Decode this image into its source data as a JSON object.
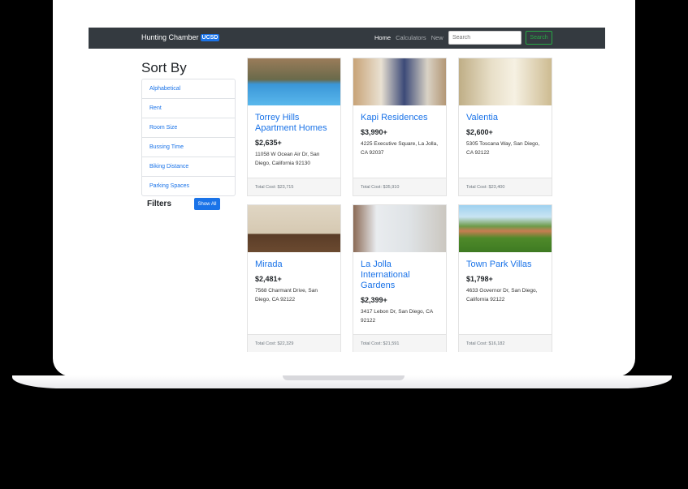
{
  "navbar": {
    "brand": "Hunting Chamber",
    "brand_badge": "UCSD",
    "links": [
      "Home",
      "Calculators",
      "New"
    ],
    "search_placeholder": "Search",
    "search_button": "Search"
  },
  "sidebar": {
    "title": "Sort By",
    "sort_options": [
      "Alphabetical",
      "Rent",
      "Room Size",
      "Bussing Time",
      "Biking Distance",
      "Parking Spaces"
    ],
    "filters_label": "Filters",
    "show_all_label": "Show All"
  },
  "listings": [
    {
      "title": "Torrey Hills Apartment Homes",
      "price": "$2,635+",
      "address": "11058 W Ocean Air Dr, San Diego, California 92130",
      "total": "Total Cost: $23,715"
    },
    {
      "title": "Kapi Residences",
      "price": "$3,990+",
      "address": "4225 Executive Square, La Jolla, CA 92037",
      "total": "Total Cost: $35,910"
    },
    {
      "title": "Valentia",
      "price": "$2,600+",
      "address": "5305 Toscana Way, San Diego, CA 92122",
      "total": "Total Cost: $23,400"
    },
    {
      "title": "Mirada",
      "price": "$2,481+",
      "address": "7568 Charmant Drive, San Diego, CA 92122",
      "total": "Total Cost: $22,329"
    },
    {
      "title": "La Jolla International Gardens",
      "price": "$2,399+",
      "address": "3417 Lebon Dr, San Diego, CA 92122",
      "total": "Total Cost: $21,591"
    },
    {
      "title": "Town Park Villas",
      "price": "$1,798+",
      "address": "4633 Governor Dr, San Diego, California 92122",
      "total": "Total Cost: $16,182"
    }
  ],
  "colors": {
    "navbar": "#343a40",
    "link": "#1a73e8",
    "search_button": "#28a745"
  }
}
